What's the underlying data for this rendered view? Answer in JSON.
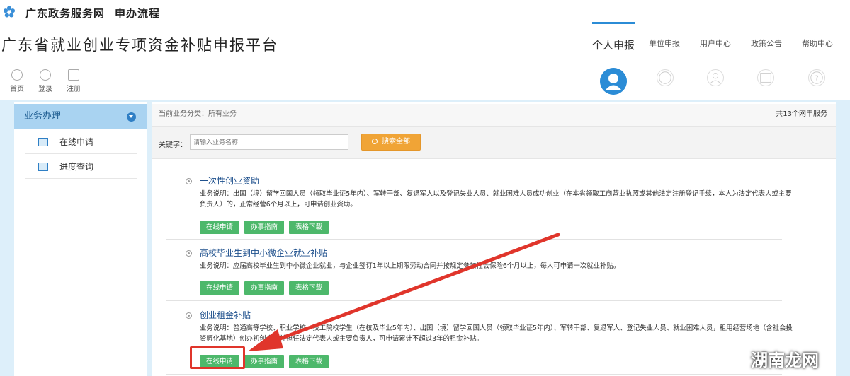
{
  "header": {
    "site_name": "广东政务服务网",
    "site_sub": "申办流程",
    "platform_title": "广东省就业创业专项资金补贴申报平台"
  },
  "nav": {
    "items": [
      {
        "label": "个人申报",
        "active": true
      },
      {
        "label": "单位申报"
      },
      {
        "label": "用户中心"
      },
      {
        "label": "政策公告"
      },
      {
        "label": "帮助中心"
      }
    ]
  },
  "quick_links": [
    {
      "label": "首页",
      "icon": "home-icon"
    },
    {
      "label": "登录",
      "icon": "login-icon"
    },
    {
      "label": "注册",
      "icon": "register-icon"
    }
  ],
  "sidebar": {
    "header": "业务办理",
    "items": [
      {
        "label": "在线申请",
        "icon": "online-apply-icon"
      },
      {
        "label": "进度查询",
        "icon": "progress-query-icon"
      }
    ]
  },
  "main": {
    "crumb": "当前业务分类：所有业务",
    "count": "共13个网申服务",
    "keyword_label": "关键字：",
    "keyword_placeholder": "请输入业务名称",
    "search_label": "搜索全部"
  },
  "services": [
    {
      "title": "一次性创业资助",
      "desc": "业务说明：出国（境）留学回国人员（领取毕业证5年内）、军转干部、复退军人以及登记失业人员、就业困难人员成功创业（在本省领取工商营业执照或其他法定注册登记手续，本人为法定代表人或主要负责人）的，正常经营6个月以上，可申请创业资助。",
      "buttons": [
        "在线申请",
        "办事指南",
        "表格下载"
      ]
    },
    {
      "title": "高校毕业生到中小微企业就业补贴",
      "desc": "业务说明：应届高校毕业生到中小微企业就业，与企业签订1年以上期限劳动合同并按规定参加社会保险6个月以上，每人可申请一次就业补贴。",
      "buttons": [
        "在线申请",
        "办事指南",
        "表格下载"
      ]
    },
    {
      "title": "创业租金补贴",
      "desc": "业务说明：普通高等学校、职业学校、技工院校学生（在校及毕业5年内）、出国（境）留学回国人员（领取毕业证5年内）、军转干部、复退军人、登记失业人员、就业困难人员，租用经营场地（含社会投资孵化基地）创办初创企业并担任法定代表人或主要负责人，可申请累计不超过3年的租金补贴。",
      "buttons": [
        "在线申请",
        "办事指南",
        "表格下载"
      ]
    }
  ],
  "watermark": "湖南龙网",
  "colors": {
    "accent": "#2b8cd6",
    "green": "#4db86b",
    "orange": "#f0a436",
    "annotation": "#e0352b"
  }
}
